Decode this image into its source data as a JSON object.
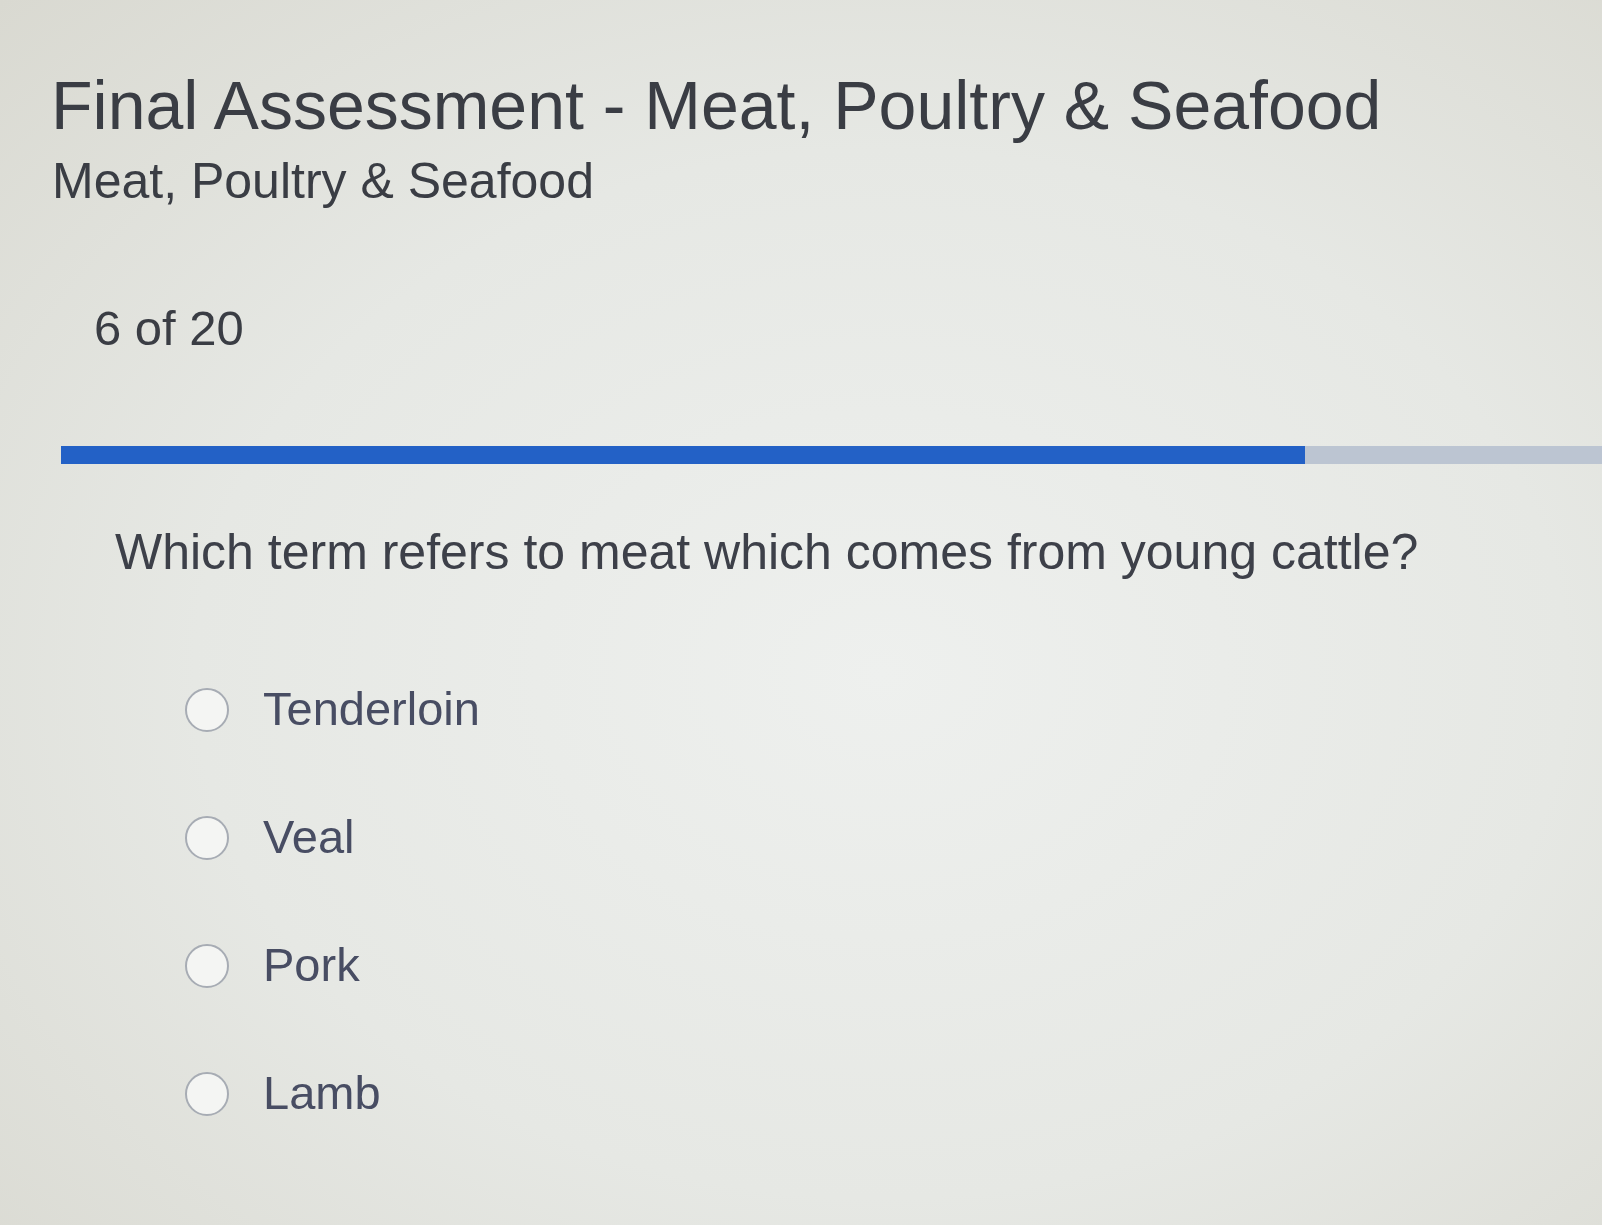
{
  "header": {
    "title": "Final Assessment - Meat, Poultry & Seafood",
    "subtitle": "Meat, Poultry & Seafood"
  },
  "progress": {
    "counter": "6 of 20",
    "level": 0.807
  },
  "question": {
    "text": "Which term refers to meat which comes from young cattle?",
    "options": [
      {
        "label": "Tenderloin",
        "selected": false
      },
      {
        "label": "Veal",
        "selected": false
      },
      {
        "label": "Pork",
        "selected": false
      },
      {
        "label": "Lamb",
        "selected": false
      }
    ]
  }
}
